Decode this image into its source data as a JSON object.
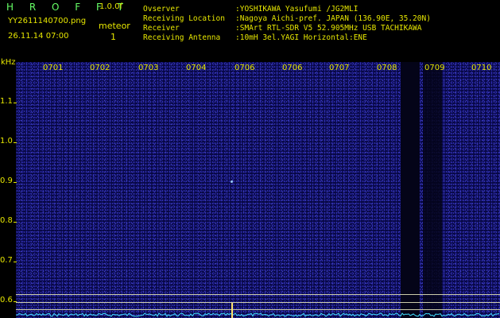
{
  "header": {
    "app_title": "H R O F F T",
    "app_version": "1.0.0f",
    "filename": "YY2611140700.png",
    "meteor_label": "meteor",
    "datetime": "26.11.14 07:00",
    "meteor_count": "1"
  },
  "info": [
    {
      "key": "Ovserver",
      "value": ":YOSHIKAWA Yasufumi /JG2MLI"
    },
    {
      "key": "Receiving Location",
      "value": ":Nagoya Aichi-pref. JAPAN (136.90E, 35.20N)"
    },
    {
      "key": "Receiver",
      "value": ":SMArt RTL-SDR V5 52.905MHz USB TACHIKAWA"
    },
    {
      "key": "Receiving Antenna",
      "value": ":10mH 3el.YAGI Horizontal:ENE"
    }
  ],
  "axis": {
    "y_unit": "kHz",
    "y_ticks": [
      "1.1",
      "1.0",
      "0.9",
      "0.8",
      "0.7",
      "0.6"
    ],
    "time_labels": [
      "0701",
      "0702",
      "0703",
      "0704",
      "0706",
      "0706",
      "0707",
      "0708",
      "0709",
      "0710"
    ]
  },
  "colors": {
    "text": "#e6e600",
    "background": "#000000",
    "spectrogram": "#080845",
    "baseline": "#40e0ff",
    "marker": "#ffe36a"
  }
}
